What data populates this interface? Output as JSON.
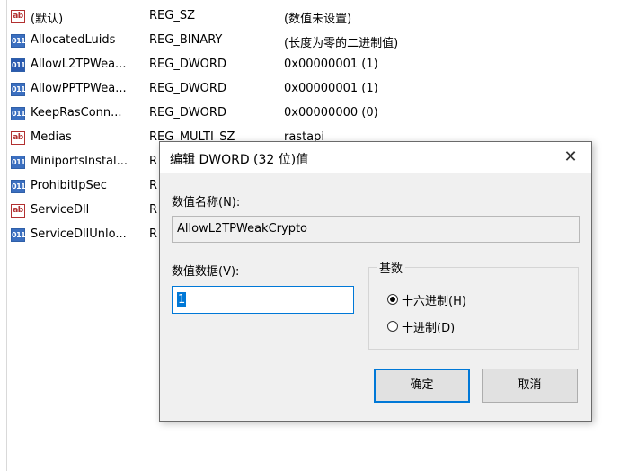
{
  "registry": {
    "rows": [
      {
        "icon": "string",
        "name": "(默认)",
        "type": "REG_SZ",
        "data": "(数值未设置)"
      },
      {
        "icon": "binary",
        "name": "AllocatedLuids",
        "type": "REG_BINARY",
        "data": "(长度为零的二进制值)"
      },
      {
        "icon": "binary",
        "name": "AllowL2TPWea...",
        "type": "REG_DWORD",
        "data": "0x00000001 (1)"
      },
      {
        "icon": "binary",
        "name": "AllowPPTPWea...",
        "type": "REG_DWORD",
        "data": "0x00000001 (1)"
      },
      {
        "icon": "binary",
        "name": "KeepRasConn...",
        "type": "REG_DWORD",
        "data": "0x00000000 (0)"
      },
      {
        "icon": "string",
        "name": "Medias",
        "type": "REG_MULTI_SZ",
        "data": "rastapi"
      },
      {
        "icon": "binary",
        "name": "MiniportsInstal...",
        "type": "R",
        "data": ""
      },
      {
        "icon": "binary",
        "name": "ProhibitIpSec",
        "type": "R",
        "data": ""
      },
      {
        "icon": "string",
        "name": "ServiceDll",
        "type": "R",
        "data": ""
      },
      {
        "icon": "binary",
        "name": "ServiceDllUnlo...",
        "type": "R",
        "data": ""
      }
    ],
    "icon_text": {
      "string": "ab",
      "binary": "011\n110"
    }
  },
  "dialog": {
    "title": "编辑 DWORD (32 位)值",
    "close": "✕",
    "value_name_label": "数值名称(N):",
    "value_name": "AllowL2TPWeakCrypto",
    "value_data_label": "数值数据(V):",
    "value_data": "1",
    "base_label": "基数",
    "radio_hex": "十六进制(H)",
    "radio_dec": "十进制(D)",
    "selected_base": "hex",
    "ok": "确定",
    "cancel": "取消"
  },
  "colors": {
    "accent": "#0078d7",
    "dialog_bg": "#f0f0f0"
  }
}
